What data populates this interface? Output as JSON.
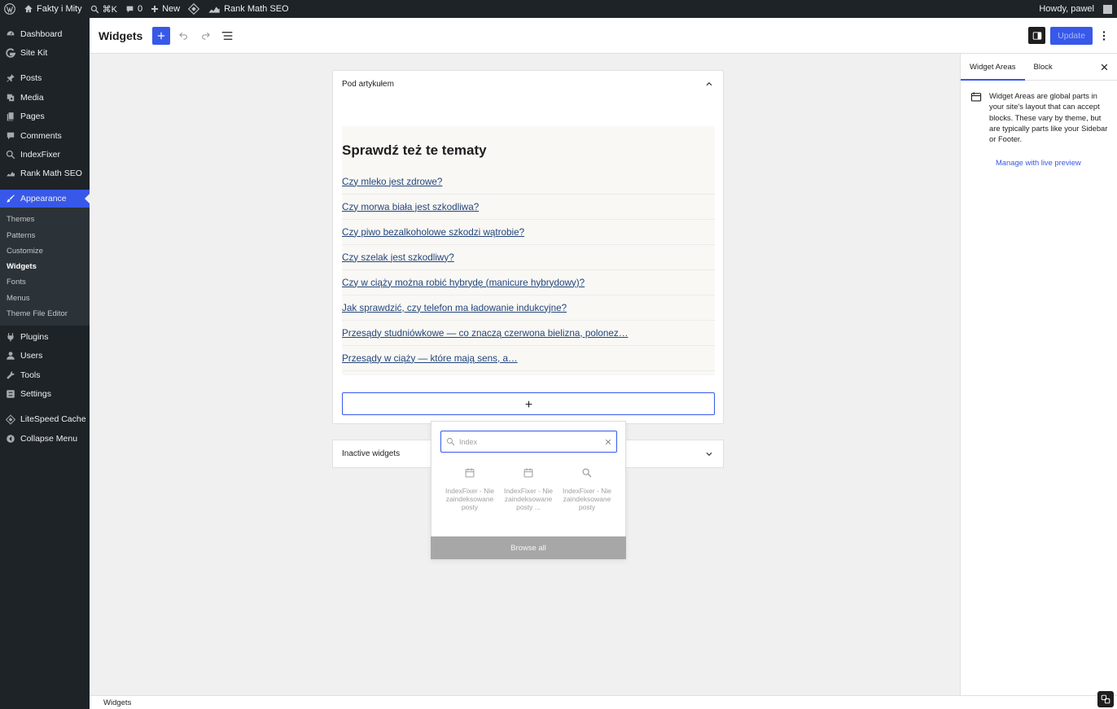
{
  "admin_bar": {
    "site_name": "Fakty i Mity",
    "search_shortcut": "⌘K",
    "comments_count": "0",
    "new_label": "New",
    "rank_math_label": "Rank Math SEO",
    "greeting": "Howdy, pawel"
  },
  "sidebar": {
    "items": [
      {
        "label": "Dashboard",
        "icon": "dashboard-icon"
      },
      {
        "label": "Site Kit",
        "icon": "sitekit-icon"
      },
      {
        "label": "Posts",
        "icon": "pin-icon"
      },
      {
        "label": "Media",
        "icon": "media-icon"
      },
      {
        "label": "Pages",
        "icon": "pages-icon"
      },
      {
        "label": "Comments",
        "icon": "comment-icon"
      },
      {
        "label": "IndexFixer",
        "icon": "search-icon"
      },
      {
        "label": "Rank Math SEO",
        "icon": "rankmath-icon"
      },
      {
        "label": "Appearance",
        "icon": "brush-icon"
      },
      {
        "label": "Plugins",
        "icon": "plugin-icon"
      },
      {
        "label": "Users",
        "icon": "users-icon"
      },
      {
        "label": "Tools",
        "icon": "wrench-icon"
      },
      {
        "label": "Settings",
        "icon": "settings-icon"
      },
      {
        "label": "LiteSpeed Cache",
        "icon": "litespeed-icon"
      },
      {
        "label": "Collapse Menu",
        "icon": "collapse-icon"
      }
    ],
    "appearance_sub": [
      "Themes",
      "Patterns",
      "Customize",
      "Widgets",
      "Fonts",
      "Menus",
      "Theme File Editor"
    ]
  },
  "header": {
    "title": "Widgets",
    "update_label": "Update"
  },
  "widget_area": {
    "title": "Pod artykułem",
    "heading": "Sprawdź też te tematy",
    "links": [
      "Czy mleko jest zdrowe?",
      "Czy morwa biała jest szkodliwa?",
      "Czy piwo bezalkoholowe szkodzi wątrobie?",
      "Czy szelak jest szkodliwy?",
      "Czy w ciąży można robić hybrydę (manicure hybrydowy)?",
      "Jak sprawdzić, czy telefon ma ładowanie indukcyjne?",
      "Przesądy studniówkowe — co znaczą czerwona bielizna, polonez…",
      "Przesądy w ciąży — które mają sens, a…"
    ]
  },
  "inactive_area": {
    "title": "Inactive widgets"
  },
  "inserter": {
    "search_value": "Index",
    "results": [
      {
        "label": "IndexFixer - Niezaindeksowane posty",
        "icon": "calendar-icon"
      },
      {
        "label": "IndexFixer - Niezaindeksowane posty ...",
        "icon": "calendar-icon"
      },
      {
        "label": "IndexFixer - Niezaindeksowane posty",
        "icon": "search-icon"
      }
    ],
    "browse_all": "Browse all"
  },
  "settings_panel": {
    "tabs": [
      "Widget Areas",
      "Block"
    ],
    "description": "Widget Areas are global parts in your site's layout that can accept blocks. These vary by theme, but are typically parts like your Sidebar or Footer.",
    "manage_link": "Manage with live preview"
  },
  "footer": {
    "breadcrumb": "Widgets"
  },
  "colors": {
    "accent": "#3858e9",
    "admin_dark": "#1d2327",
    "link": "#23467b"
  }
}
